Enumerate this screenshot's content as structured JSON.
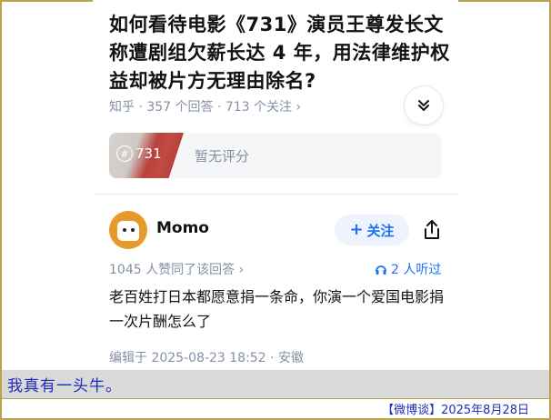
{
  "question": {
    "title": "如何看待电影《731》演员王尊发长文称遭剧组欠薪长达 4 年，用法律维护权益却被片方无理由除名?",
    "meta": "知乎 · 357 个回答 · 713 个关注 ›"
  },
  "movie_card": {
    "poster_label": "731",
    "rating_text": "暂无评分"
  },
  "answer": {
    "author": "Momo",
    "follow_label": "关注",
    "upvote_text": "1045 人赞同了该回答 ›",
    "listening_text": "2 人听过",
    "content": "老百姓打日本都愿意捐一条命，你演一个爱国电影捐一次片酬怎么了",
    "edited_text": "编辑于 2025-08-23 18:52 · 安徽"
  },
  "overlay": {
    "caption": "我真有一头牛。",
    "source": "【微博谈】2025年8月28日"
  },
  "colors": {
    "accent_blue": "#1772f6",
    "caption_blue": "#1d2db8",
    "border_gold": "#b9a44a",
    "avatar_orange": "#e79a2c"
  },
  "icons": [
    "chevron-double-down-icon",
    "hash-icon",
    "plus-icon",
    "share-icon",
    "headphones-icon"
  ]
}
